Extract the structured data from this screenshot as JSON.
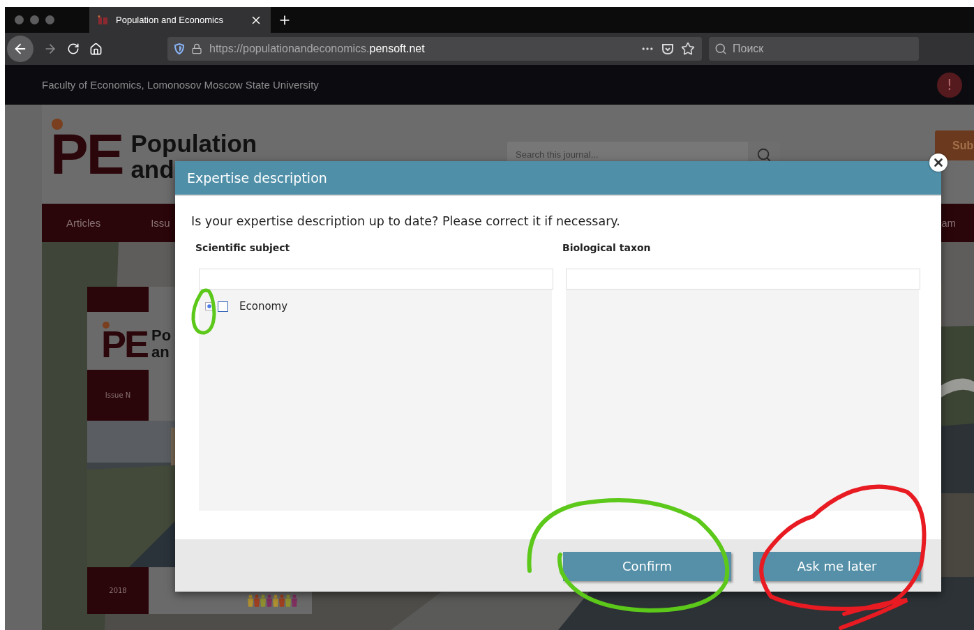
{
  "browser": {
    "tab": {
      "title": "Population and Economics",
      "selected": true
    },
    "url": "https://populationandeconomics.**pensoft.net**",
    "search": {
      "placeholder": "Поиск"
    }
  },
  "site": {
    "top_bar": {
      "text": "Faculty of Economics, Lomonosov Moscow State University",
      "alert": "!"
    },
    "logo": {
      "mark": "PE",
      "name_lines": [
        "Population",
        "and"
      ]
    },
    "search": {
      "placeholder": "Search this journal..."
    },
    "submit_button": "Sub",
    "nav": [
      {
        "label": "Articles"
      },
      {
        "label": "Issu"
      },
      {
        "label": "am"
      }
    ],
    "cover": {
      "logo_mark": "PE",
      "name_lines": [
        "Po",
        "an"
      ],
      "issue": "Issue N",
      "year": "2018"
    }
  },
  "dialog": {
    "title": "Expertise description",
    "question": "Is your expertise description up to date? Please correct it if necessary.",
    "columns": [
      {
        "label": "Scientific subject",
        "tree": [
          {
            "label": "Economy",
            "expanded": false,
            "checked": false
          }
        ]
      },
      {
        "label": "Biological taxon"
      }
    ],
    "buttons": [
      {
        "label": "Confirm"
      },
      {
        "label": "Ask me later"
      }
    ]
  }
}
